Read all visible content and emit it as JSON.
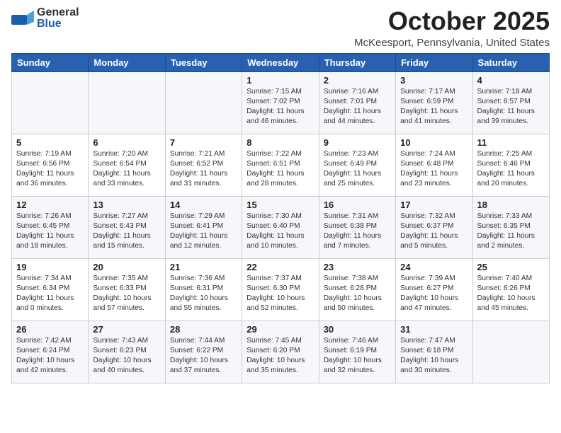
{
  "header": {
    "logo_line1": "General",
    "logo_line2": "Blue",
    "month": "October 2025",
    "location": "McKeesport, Pennsylvania, United States"
  },
  "weekdays": [
    "Sunday",
    "Monday",
    "Tuesday",
    "Wednesday",
    "Thursday",
    "Friday",
    "Saturday"
  ],
  "weeks": [
    [
      {
        "day": "",
        "info": ""
      },
      {
        "day": "",
        "info": ""
      },
      {
        "day": "",
        "info": ""
      },
      {
        "day": "1",
        "info": "Sunrise: 7:15 AM\nSunset: 7:02 PM\nDaylight: 11 hours\nand 46 minutes."
      },
      {
        "day": "2",
        "info": "Sunrise: 7:16 AM\nSunset: 7:01 PM\nDaylight: 11 hours\nand 44 minutes."
      },
      {
        "day": "3",
        "info": "Sunrise: 7:17 AM\nSunset: 6:59 PM\nDaylight: 11 hours\nand 41 minutes."
      },
      {
        "day": "4",
        "info": "Sunrise: 7:18 AM\nSunset: 6:57 PM\nDaylight: 11 hours\nand 39 minutes."
      }
    ],
    [
      {
        "day": "5",
        "info": "Sunrise: 7:19 AM\nSunset: 6:56 PM\nDaylight: 11 hours\nand 36 minutes."
      },
      {
        "day": "6",
        "info": "Sunrise: 7:20 AM\nSunset: 6:54 PM\nDaylight: 11 hours\nand 33 minutes."
      },
      {
        "day": "7",
        "info": "Sunrise: 7:21 AM\nSunset: 6:52 PM\nDaylight: 11 hours\nand 31 minutes."
      },
      {
        "day": "8",
        "info": "Sunrise: 7:22 AM\nSunset: 6:51 PM\nDaylight: 11 hours\nand 28 minutes."
      },
      {
        "day": "9",
        "info": "Sunrise: 7:23 AM\nSunset: 6:49 PM\nDaylight: 11 hours\nand 25 minutes."
      },
      {
        "day": "10",
        "info": "Sunrise: 7:24 AM\nSunset: 6:48 PM\nDaylight: 11 hours\nand 23 minutes."
      },
      {
        "day": "11",
        "info": "Sunrise: 7:25 AM\nSunset: 6:46 PM\nDaylight: 11 hours\nand 20 minutes."
      }
    ],
    [
      {
        "day": "12",
        "info": "Sunrise: 7:26 AM\nSunset: 6:45 PM\nDaylight: 11 hours\nand 18 minutes."
      },
      {
        "day": "13",
        "info": "Sunrise: 7:27 AM\nSunset: 6:43 PM\nDaylight: 11 hours\nand 15 minutes."
      },
      {
        "day": "14",
        "info": "Sunrise: 7:29 AM\nSunset: 6:41 PM\nDaylight: 11 hours\nand 12 minutes."
      },
      {
        "day": "15",
        "info": "Sunrise: 7:30 AM\nSunset: 6:40 PM\nDaylight: 11 hours\nand 10 minutes."
      },
      {
        "day": "16",
        "info": "Sunrise: 7:31 AM\nSunset: 6:38 PM\nDaylight: 11 hours\nand 7 minutes."
      },
      {
        "day": "17",
        "info": "Sunrise: 7:32 AM\nSunset: 6:37 PM\nDaylight: 11 hours\nand 5 minutes."
      },
      {
        "day": "18",
        "info": "Sunrise: 7:33 AM\nSunset: 6:35 PM\nDaylight: 11 hours\nand 2 minutes."
      }
    ],
    [
      {
        "day": "19",
        "info": "Sunrise: 7:34 AM\nSunset: 6:34 PM\nDaylight: 11 hours\nand 0 minutes."
      },
      {
        "day": "20",
        "info": "Sunrise: 7:35 AM\nSunset: 6:33 PM\nDaylight: 10 hours\nand 57 minutes."
      },
      {
        "day": "21",
        "info": "Sunrise: 7:36 AM\nSunset: 6:31 PM\nDaylight: 10 hours\nand 55 minutes."
      },
      {
        "day": "22",
        "info": "Sunrise: 7:37 AM\nSunset: 6:30 PM\nDaylight: 10 hours\nand 52 minutes."
      },
      {
        "day": "23",
        "info": "Sunrise: 7:38 AM\nSunset: 6:28 PM\nDaylight: 10 hours\nand 50 minutes."
      },
      {
        "day": "24",
        "info": "Sunrise: 7:39 AM\nSunset: 6:27 PM\nDaylight: 10 hours\nand 47 minutes."
      },
      {
        "day": "25",
        "info": "Sunrise: 7:40 AM\nSunset: 6:26 PM\nDaylight: 10 hours\nand 45 minutes."
      }
    ],
    [
      {
        "day": "26",
        "info": "Sunrise: 7:42 AM\nSunset: 6:24 PM\nDaylight: 10 hours\nand 42 minutes."
      },
      {
        "day": "27",
        "info": "Sunrise: 7:43 AM\nSunset: 6:23 PM\nDaylight: 10 hours\nand 40 minutes."
      },
      {
        "day": "28",
        "info": "Sunrise: 7:44 AM\nSunset: 6:22 PM\nDaylight: 10 hours\nand 37 minutes."
      },
      {
        "day": "29",
        "info": "Sunrise: 7:45 AM\nSunset: 6:20 PM\nDaylight: 10 hours\nand 35 minutes."
      },
      {
        "day": "30",
        "info": "Sunrise: 7:46 AM\nSunset: 6:19 PM\nDaylight: 10 hours\nand 32 minutes."
      },
      {
        "day": "31",
        "info": "Sunrise: 7:47 AM\nSunset: 6:18 PM\nDaylight: 10 hours\nand 30 minutes."
      },
      {
        "day": "",
        "info": ""
      }
    ]
  ]
}
